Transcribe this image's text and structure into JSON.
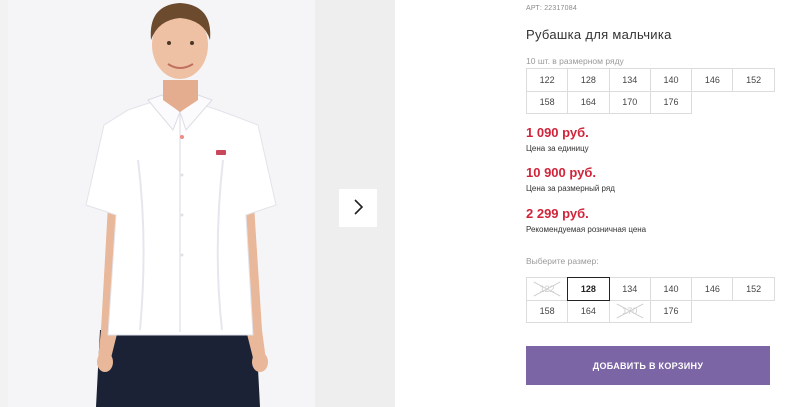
{
  "product": {
    "article": "АРТ: 22317084",
    "title": "Рубашка для мальчика",
    "pack_note": "10 шт. в размерном ряду",
    "pack_sizes": [
      "122",
      "128",
      "134",
      "140",
      "146",
      "152",
      "158",
      "164",
      "170",
      "176"
    ],
    "prices": [
      {
        "value": "1 090 руб.",
        "label": "Цена за единицу"
      },
      {
        "value": "10 900 руб.",
        "label": "Цена за размерный ряд"
      },
      {
        "value": "2 299 руб.",
        "label": "Рекомендуемая розничная цена"
      }
    ],
    "size_select_label": "Выберите размер:",
    "sizes": [
      {
        "label": "122",
        "state": "unavailable"
      },
      {
        "label": "128",
        "state": "selected"
      },
      {
        "label": "134",
        "state": "available"
      },
      {
        "label": "140",
        "state": "available"
      },
      {
        "label": "146",
        "state": "available"
      },
      {
        "label": "152",
        "state": "available"
      },
      {
        "label": "158",
        "state": "available"
      },
      {
        "label": "164",
        "state": "available"
      },
      {
        "label": "170",
        "state": "unavailable"
      },
      {
        "label": "176",
        "state": "available"
      }
    ],
    "add_to_cart_label": "ДОБАВИТЬ В КОРЗИНУ"
  },
  "gallery": {
    "next_icon": "chevron-right-icon"
  },
  "colors": {
    "price": "#d0243a",
    "button": "#7c65a5"
  }
}
